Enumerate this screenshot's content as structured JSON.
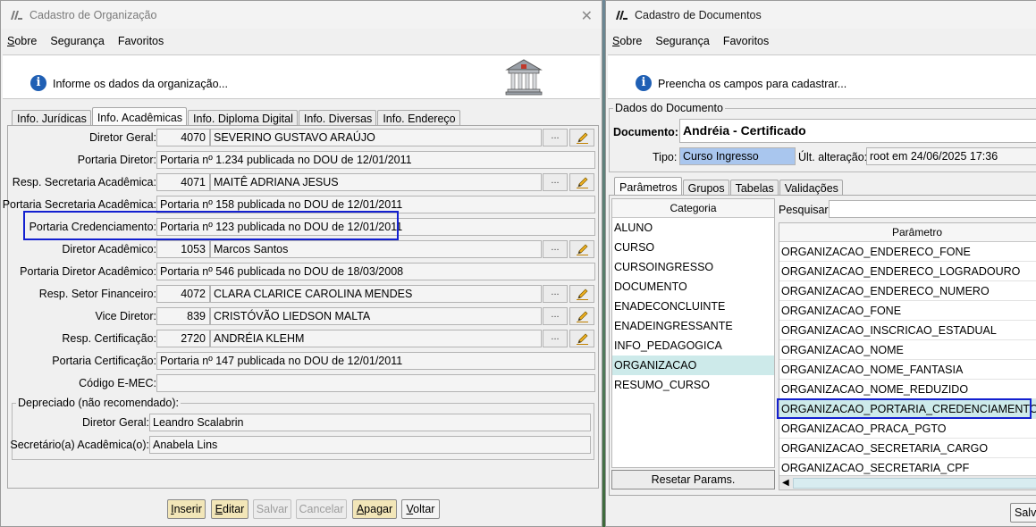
{
  "left_window": {
    "title": "Cadastro de Organização",
    "menu": [
      "Sobre",
      "Segurança",
      "Favoritos"
    ],
    "info_text": "Informe os dados da organização...",
    "tabs": [
      "Info. Jurídicas",
      "Info. Acadêmicas",
      "Info. Diploma Digital",
      "Info. Diversas",
      "Info. Endereço"
    ],
    "selected_tab": "Info. Acadêmicas",
    "fields": [
      {
        "label": "Diretor Geral:",
        "code": "4070",
        "value": "SEVERINO GUSTAVO ARAÚJO"
      },
      {
        "label": "Portaria Diretor:",
        "value": "Portaria nº 1.234 publicada no DOU de 12/01/2011"
      },
      {
        "label": "Resp. Secretaria Acadêmica:",
        "code": "4071",
        "value": "MAITÊ ADRIANA JESUS"
      },
      {
        "label": "Portaria Secretaria Acadêmica:",
        "value": "Portaria nº 158 publicada no DOU de 12/01/2011"
      },
      {
        "label": "Portaria Credenciamento:",
        "value": "Portaria nº 123 publicada no DOU de 12/01/2011"
      },
      {
        "label": "Diretor Acadêmico:",
        "code": "1053",
        "value": "Marcos Santos"
      },
      {
        "label": "Portaria Diretor Acadêmico:",
        "value": "Portaria nº 546 publicada no DOU de 18/03/2008"
      },
      {
        "label": "Resp. Setor Financeiro:",
        "code": "4072",
        "value": "CLARA CLARICE CAROLINA MENDES"
      },
      {
        "label": "Vice Diretor:",
        "code": "839",
        "value": "CRISTÓVÃO LIEDSON MALTA"
      },
      {
        "label": "Resp. Certificação:",
        "code": "2720",
        "value": "ANDRÉIA KLEHM"
      },
      {
        "label": "Portaria Certificação:",
        "value": "Portaria nº 147 publicada no DOU de 12/01/2011"
      },
      {
        "label": "Código E-MEC:",
        "value": ""
      }
    ],
    "lookup_button": "...",
    "deprecated": {
      "title": "Depreciado (não recomendado):",
      "fields": [
        {
          "label": "Diretor Geral:",
          "value": "Leandro Scalabrin"
        },
        {
          "label": "Secretário(a) Acadêmica(o):",
          "value": "Anabela Lins"
        }
      ]
    },
    "buttons": [
      "Inserir",
      "Editar",
      "Salvar",
      "Cancelar",
      "Apagar",
      "Voltar"
    ]
  },
  "right_window": {
    "title": "Cadastro de Documentos",
    "menu": [
      "Sobre",
      "Segurança",
      "Favoritos"
    ],
    "info_text": "Preencha os campos para cadastrar...",
    "section_title": "Dados do Documento",
    "documento_label": "Documento:",
    "documento_value": "Andréia - Certificado",
    "tipo_label": "Tipo:",
    "tipo_value": "Curso Ingresso",
    "ult_alteracao_label": "Últ. alteração:",
    "ult_alteracao_value": "root em 24/06/2025 17:36",
    "tabs": [
      "Parâmetros",
      "Grupos",
      "Tabelas",
      "Validações"
    ],
    "selected_tab": "Parâmetros",
    "categoria_header": "Categoria",
    "categorias": [
      "ALUNO",
      "CURSO",
      "CURSOINGRESSO",
      "DOCUMENTO",
      "ENADECONCLUINTE",
      "ENADEINGRESSANTE",
      "INFO_PEDAGOGICA",
      "ORGANIZACAO",
      "RESUMO_CURSO"
    ],
    "selected_categoria": "ORGANIZACAO",
    "reset_button": "Resetar Params.",
    "search_label": "Pesquisar:",
    "search_value": "",
    "parametro_header": "Parâmetro",
    "parametros": [
      "ORGANIZACAO_ENDERECO_FONE",
      "ORGANIZACAO_ENDERECO_LOGRADOURO",
      "ORGANIZACAO_ENDERECO_NUMERO",
      "ORGANIZACAO_FONE",
      "ORGANIZACAO_INSCRICAO_ESTADUAL",
      "ORGANIZACAO_NOME",
      "ORGANIZACAO_NOME_FANTASIA",
      "ORGANIZACAO_NOME_REDUZIDO",
      "ORGANIZACAO_PORTARIA_CREDENCIAMENTO",
      "ORGANIZACAO_PRACA_PGTO",
      "ORGANIZACAO_SECRETARIA_CARGO",
      "ORGANIZACAO_SECRETARIA_CPF"
    ],
    "selected_parametro": "ORGANIZACAO_PORTARIA_CREDENCIAMENTO",
    "save_button_partial": "Salva"
  },
  "colors": {
    "highlight_box": "#1320d0",
    "selection": "#cdeaea",
    "tipo_bg": "#a9c6ee",
    "action_button": "#f2e6b8"
  }
}
